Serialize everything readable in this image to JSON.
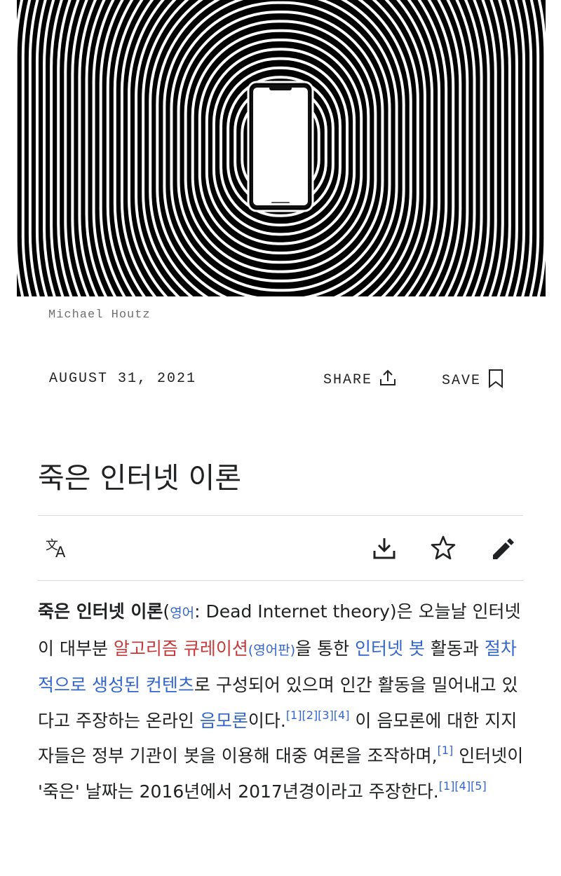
{
  "hero": {
    "image_desc": "fingerprint-phone-illustration",
    "credit": "Michael Houtz"
  },
  "meta": {
    "date": "AUGUST 31, 2021",
    "share_label": "SHARE",
    "save_label": "SAVE"
  },
  "title": "죽은 인터넷 이론",
  "toolbar": {
    "language_icon": "translate-icon",
    "download_icon": "download-icon",
    "watch_icon": "star-icon",
    "edit_icon": "pencil-icon"
  },
  "article": {
    "s1_bold": "죽은 인터넷 이론",
    "s1_paren_open": "(",
    "s1_lang_link": "영어",
    "s1_colon": ": Dead Internet theory)은 오늘날 인터넷이 대부분 ",
    "s1_algo_link": "알고리즘 큐레이션",
    "s1_en_link": "(영어판)",
    "s1_after_en": "을 통한 ",
    "s1_bot_link": "인터넷 봇",
    "s1_after_bot": " 활동과 ",
    "s1_proc_link": "절차적으로 생성된 컨텐츠",
    "s1_after_proc": "로 구성되어 있으며 인간 활동을 밀어내고 있다고 주장하는 온라인 ",
    "s1_consp_link": "음모론",
    "s1_end": "이다.",
    "s1_refs": "[1][2][3][4]",
    "s2_text": " 이 음모론에 대한 지지자들은 정부 기관이 봇을 이용해 대중 여론을 조작하며,",
    "s2_refs": "[1]",
    "s3_text": " 인터넷이 '죽은' 날짜는 2016년에서 2017년경이라고 주장한다.",
    "s3_refs": "[1][4][5]"
  },
  "colors": {
    "link": "#3366cc",
    "redlink": "#c53a3a",
    "text": "#202122"
  }
}
